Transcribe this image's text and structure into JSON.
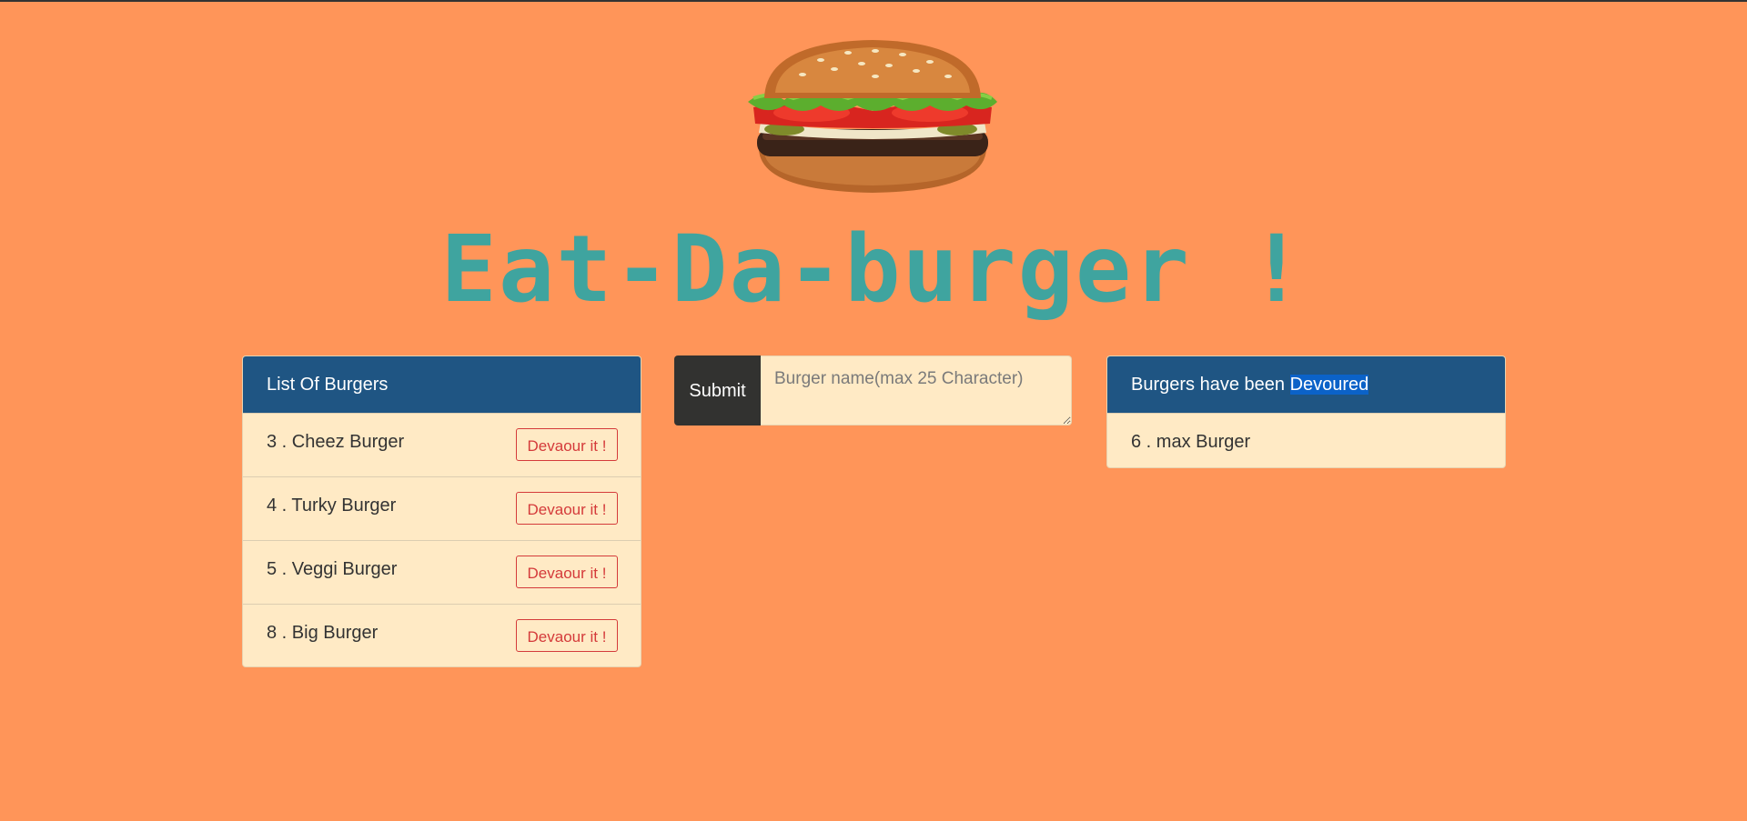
{
  "header": {
    "title": "Eat-Da-burger !"
  },
  "burger_list": {
    "title": "List Of Burgers",
    "items": [
      {
        "label": "3 . Cheez Burger",
        "button": "Devaour it !"
      },
      {
        "label": "4 . Turky Burger",
        "button": "Devaour it !"
      },
      {
        "label": "5 . Veggi Burger",
        "button": "Devaour it !"
      },
      {
        "label": "8 . Big Burger",
        "button": "Devaour it !"
      }
    ]
  },
  "form": {
    "submit_label": "Submit",
    "placeholder": "Burger name(max 25 Character)",
    "value": ""
  },
  "devoured": {
    "title_prefix": "Burgers have been ",
    "title_highlight": "Devoured",
    "items": [
      {
        "label": "6 . max Burger"
      }
    ]
  },
  "colors": {
    "background": "#ff9559",
    "title": "#3fa49f",
    "card_header": "#1f5583",
    "card_body": "#ffeac5",
    "danger": "#d43a3a",
    "submit": "#323230"
  }
}
